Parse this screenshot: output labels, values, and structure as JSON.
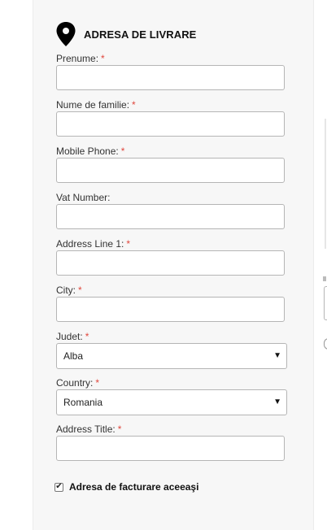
{
  "header": {
    "title": "ADRESA DE LIVRARE",
    "icon": "map-pin-icon"
  },
  "fields": [
    {
      "label": "Prenume:",
      "required": "*",
      "value": ""
    },
    {
      "label": "Nume de familie:",
      "required": "*",
      "value": ""
    },
    {
      "label": "Mobile Phone:",
      "required": "*",
      "value": ""
    },
    {
      "label": "Vat Number:",
      "required": "",
      "value": ""
    },
    {
      "label": "Address Line 1:",
      "required": "*",
      "value": ""
    },
    {
      "label": "City:",
      "required": "*",
      "value": ""
    },
    {
      "label": "Judet:",
      "required": "*",
      "value": "Alba"
    },
    {
      "label": "Country:",
      "required": "*",
      "value": "Romania"
    },
    {
      "label": "Address Title:",
      "required": "*",
      "value": ""
    }
  ],
  "select_arrow": "▼",
  "checkbox": {
    "label": "Adresa de facturare aceeaşi",
    "checked": true,
    "mark": "✔"
  },
  "colors": {
    "required": "#e0473d",
    "panel": "#f7f7f7",
    "border": "#b5b5b5"
  }
}
